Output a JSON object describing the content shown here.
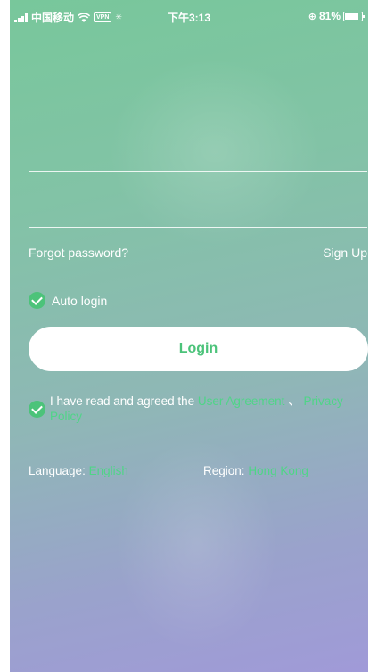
{
  "status_bar": {
    "carrier": "中国移动",
    "vpn": "VPN",
    "time": "下午3:13",
    "battery": "81%",
    "battery_level": 0.81
  },
  "form": {
    "forgot_password": "Forgot password?",
    "sign_up": "Sign Up",
    "auto_login": "Auto login",
    "login_button": "Login"
  },
  "agreement": {
    "prefix": "I have read and agreed the ",
    "user_agreement": "User Agreement",
    "separator": " 、 ",
    "privacy_policy": "Privacy Policy"
  },
  "settings": {
    "language_label": "Language:",
    "language_value": "English",
    "region_label": "Region:",
    "region_value": "Hong Kong"
  },
  "colors": {
    "accent": "#4cc37a",
    "link": "#4fd587"
  }
}
